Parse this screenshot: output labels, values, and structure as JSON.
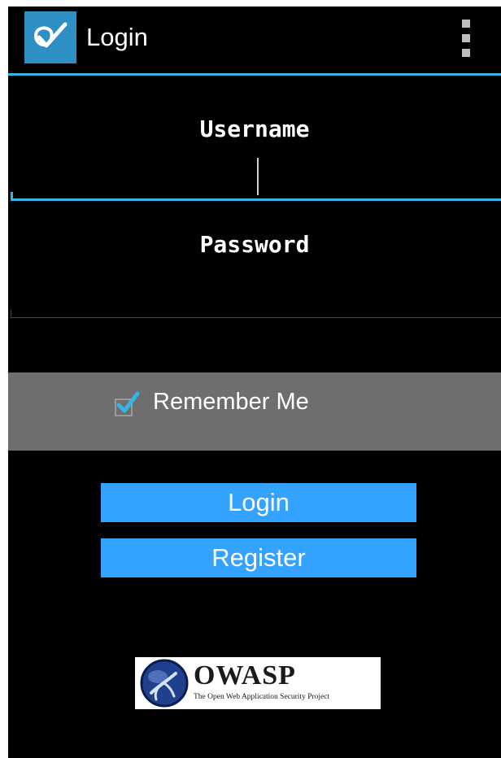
{
  "action_bar": {
    "title": "Login",
    "app_icon": "check-shield-icon",
    "menu_icon": "overflow-menu-icon"
  },
  "form": {
    "username_label": "Username",
    "password_label": "Password",
    "username_value": "",
    "password_value": ""
  },
  "remember": {
    "label": "Remember Me",
    "checked": true
  },
  "buttons": {
    "login": "Login",
    "register": "Register"
  },
  "logo": {
    "name": "OWASP",
    "tagline": "The Open Web Application Security Project"
  },
  "colors": {
    "accent": "#33b5e5",
    "button": "#33a3ff",
    "panel": "#6e6e6e",
    "background": "#000000"
  }
}
